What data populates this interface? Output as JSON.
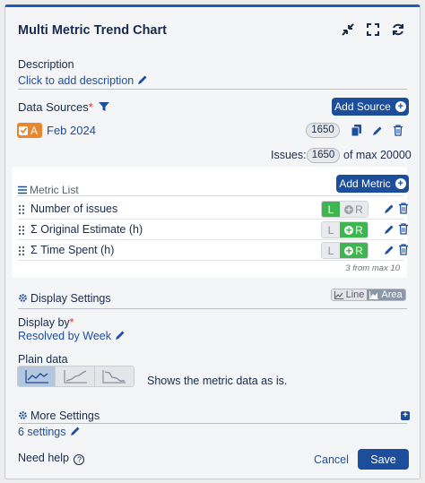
{
  "header": {
    "title": "Multi Metric Trend Chart"
  },
  "description": {
    "label": "Description",
    "link": "Click to add description"
  },
  "data_sources": {
    "label": "Data Sources",
    "required_mark": "*",
    "add_button": "Add Source",
    "source": {
      "badge": "A",
      "name": "Feb 2024",
      "count": "1650"
    },
    "issues_label": "Issues:",
    "issues_count": "1650",
    "issues_max": "of max 20000"
  },
  "metric_list": {
    "label": "Metric List",
    "add_button": "Add Metric",
    "items": [
      {
        "name": "Number of issues",
        "active": "L"
      },
      {
        "name": "Σ Original Estimate (h)",
        "active": "R"
      },
      {
        "name": "Σ Time Spent (h)",
        "active": "R"
      }
    ],
    "left_label": "L",
    "right_label": "R",
    "count_text": "3 from max 10"
  },
  "display_settings": {
    "label": "Display Settings",
    "toggle": {
      "line": "Line",
      "area": "Area",
      "selected": "area"
    },
    "display_by_label": "Display by",
    "display_by_required": "*",
    "display_by_value": "Resolved by Week",
    "plain_data_label": "Plain data",
    "plain_data_desc": "Shows the metric data as is.",
    "plain_data_selected": 0
  },
  "more_settings": {
    "label": "More Settings",
    "link": "6 settings"
  },
  "footer": {
    "help": "Need help",
    "cancel": "Cancel",
    "save": "Save"
  },
  "colors": {
    "primary": "#1d4e9b",
    "toggle_on": "#3fb54f",
    "accent_orange": "#e8872d"
  }
}
